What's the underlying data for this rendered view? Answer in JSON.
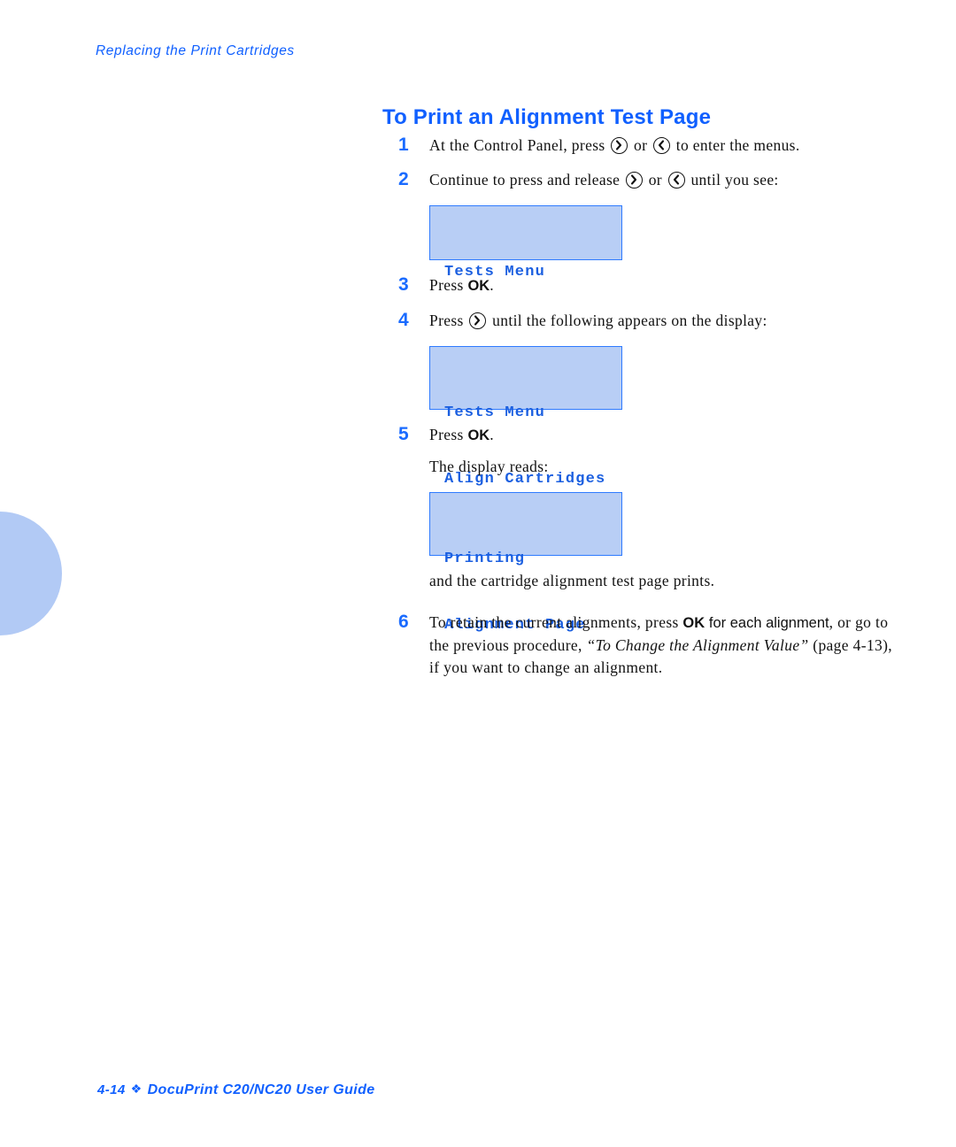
{
  "page": {
    "running_header": "Replacing the Print Cartridges",
    "section_title": "To Print an Alignment Test Page",
    "accent_blue": "#1060ff",
    "lcd_fill": "#b8cef5",
    "lcd_border": "#2f7bff",
    "lcd_text_color": "#1b5fe0",
    "tab_color": "#b2caf5"
  },
  "steps": {
    "s1": {
      "num": "1",
      "t1": "At the Control Panel, press",
      "t2": "or",
      "t3": "to enter the menus."
    },
    "s2": {
      "num": "2",
      "t1": "Continue to press and release",
      "t2": "or",
      "t3": "until you see:"
    },
    "s3": {
      "num": "3",
      "t1": "Press",
      "t2": "OK",
      "t3": "."
    },
    "s4": {
      "num": "4",
      "t1": "Press",
      "t2": "until the following appears on the display:"
    },
    "s5": {
      "num": "5",
      "t1": "Press",
      "t2": "OK",
      "t3": ".",
      "sub": "The display reads:",
      "after": "and the cartridge alignment test page prints."
    },
    "s6": {
      "num": "6",
      "t1": "To retain the current alignments, press",
      "t2": "OK",
      "t3": "for each alignment",
      "t4": ", or go to the previous procedure,",
      "t5": "“To Change the Alignment Value”",
      "t6": "(page 4-13), if you want to change an alignment."
    }
  },
  "lcd": {
    "box1": {
      "line1": "Tests Menu",
      "line2": ""
    },
    "box2": {
      "line1": "Tests Menu",
      "line2": "Align Cartridges"
    },
    "box3": {
      "line1": "Printing",
      "line2": "Alignment Page"
    }
  },
  "footer": {
    "page_number": "4-14",
    "separator": "❖",
    "guide_title": "DocuPrint C20/NC20 User Guide"
  }
}
